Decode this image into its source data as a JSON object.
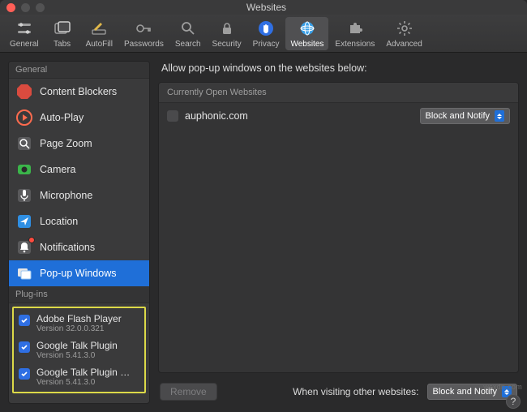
{
  "window": {
    "title": "Websites"
  },
  "toolbar": {
    "items": [
      {
        "id": "general",
        "label": "General"
      },
      {
        "id": "tabs",
        "label": "Tabs"
      },
      {
        "id": "autofill",
        "label": "AutoFill"
      },
      {
        "id": "passwords",
        "label": "Passwords"
      },
      {
        "id": "search",
        "label": "Search"
      },
      {
        "id": "security",
        "label": "Security"
      },
      {
        "id": "privacy",
        "label": "Privacy"
      },
      {
        "id": "websites",
        "label": "Websites",
        "selected": true
      },
      {
        "id": "extensions",
        "label": "Extensions"
      },
      {
        "id": "advanced",
        "label": "Advanced"
      }
    ]
  },
  "sidebar": {
    "sections": {
      "general_header": "General",
      "plugins_header": "Plug-ins"
    },
    "items": [
      {
        "id": "content-blockers",
        "label": "Content Blockers"
      },
      {
        "id": "auto-play",
        "label": "Auto-Play"
      },
      {
        "id": "page-zoom",
        "label": "Page Zoom"
      },
      {
        "id": "camera",
        "label": "Camera"
      },
      {
        "id": "microphone",
        "label": "Microphone"
      },
      {
        "id": "location",
        "label": "Location"
      },
      {
        "id": "notifications",
        "label": "Notifications",
        "badge": true
      },
      {
        "id": "popup-windows",
        "label": "Pop-up Windows",
        "selected": true
      }
    ],
    "plugins": [
      {
        "name": "Adobe Flash Player",
        "version": "Version 32.0.0.321",
        "checked": true
      },
      {
        "name": "Google Talk Plugin",
        "version": "Version 5.41.3.0",
        "checked": true
      },
      {
        "name": "Google Talk Plugin Vid…",
        "version": "Version 5.41.3.0",
        "checked": true
      }
    ]
  },
  "main": {
    "heading": "Allow pop-up windows on the websites below:",
    "currently_open_header": "Currently Open Websites",
    "sites": [
      {
        "host": "auphonic.com",
        "policy": "Block and Notify"
      }
    ],
    "remove_label": "Remove",
    "other_label": "When visiting other websites:",
    "other_policy": "Block and Notify"
  },
  "watermark": "wsxdn.com"
}
